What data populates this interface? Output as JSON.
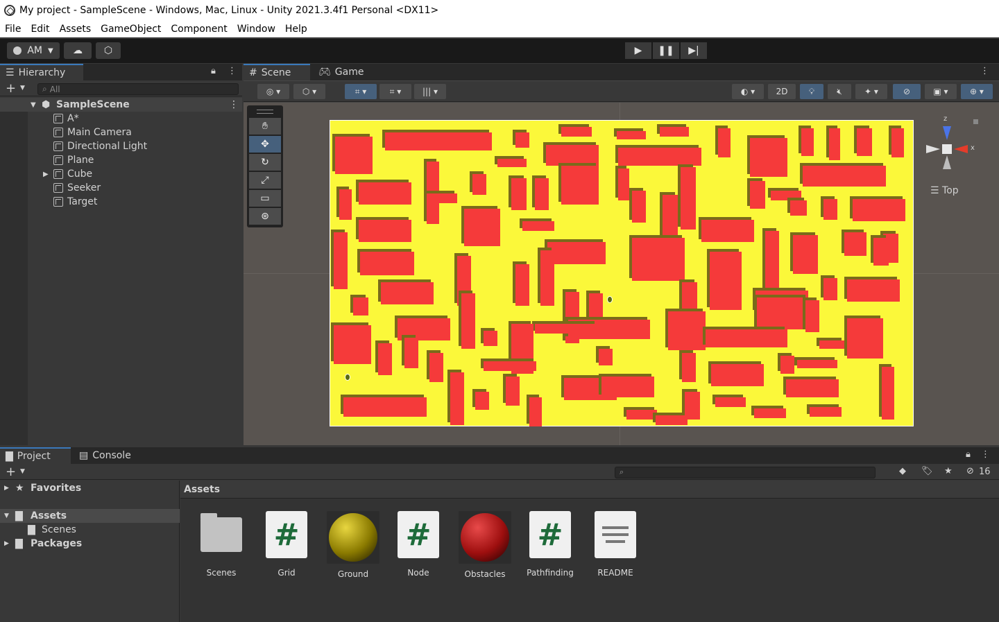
{
  "window": {
    "title": "My project - SampleScene - Windows, Mac, Linux - Unity 2021.3.4f1 Personal <DX11>"
  },
  "menu": [
    "File",
    "Edit",
    "Assets",
    "GameObject",
    "Component",
    "Window",
    "Help"
  ],
  "toolbar": {
    "account": "AM",
    "account_icon": "user-icon",
    "cloud_icon": "cloud-icon",
    "collab_icon": "collab-icon",
    "play_icon": "play-icon",
    "pause_icon": "pause-icon",
    "step_icon": "step-icon"
  },
  "hierarchy": {
    "tab_label": "Hierarchy",
    "search_placeholder": "All",
    "scene_name": "SampleScene",
    "items": [
      {
        "label": "A*"
      },
      {
        "label": "Main Camera"
      },
      {
        "label": "Directional Light"
      },
      {
        "label": "Plane"
      },
      {
        "label": "Cube"
      },
      {
        "label": "Seeker"
      },
      {
        "label": "Target"
      }
    ]
  },
  "scene": {
    "tabs": [
      {
        "label": "Scene"
      },
      {
        "label": "Game"
      }
    ],
    "view_2d_label": "2D",
    "orientation_label": "Top",
    "gizmo_axes": {
      "z": "z",
      "x": "x"
    },
    "colors": {
      "plane": "#fbf83a",
      "obstacle": "#f53a3a",
      "obstacle_shadow": "#7a6a1a",
      "background": "#595450"
    }
  },
  "project": {
    "tabs": [
      {
        "label": "Project"
      },
      {
        "label": "Console"
      }
    ],
    "hidden_count": "16",
    "tree": [
      {
        "label": "Favorites"
      },
      {
        "label": "Assets"
      },
      {
        "label": "Scenes"
      },
      {
        "label": "Packages"
      }
    ],
    "breadcrumb": "Assets",
    "assets": [
      {
        "label": "Scenes",
        "icon": "folder-icon"
      },
      {
        "label": "Grid",
        "icon": "csharp-script-icon"
      },
      {
        "label": "Ground",
        "icon": "material-icon"
      },
      {
        "label": "Node",
        "icon": "csharp-script-icon"
      },
      {
        "label": "Obstacles",
        "icon": "material-icon"
      },
      {
        "label": "Pathfinding",
        "icon": "csharp-script-icon"
      },
      {
        "label": "README",
        "icon": "text-document-icon"
      }
    ],
    "colors": {
      "ground_material": "#8a7a00",
      "obstacles_material": "#9e0f0f",
      "script_hash": "#1e6b3a"
    }
  }
}
